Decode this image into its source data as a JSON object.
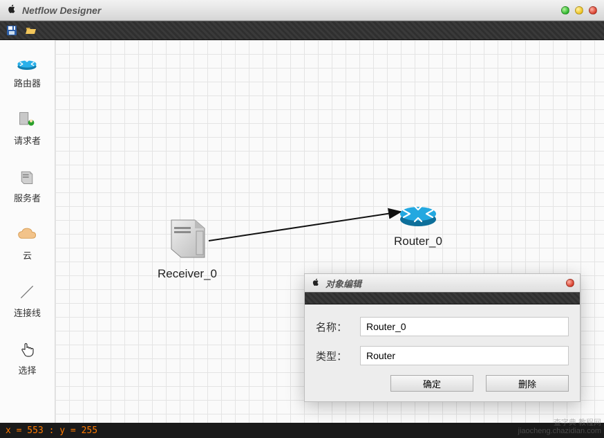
{
  "app": {
    "title": "Netflow Designer"
  },
  "palette": {
    "router_label": "路由器",
    "requester_label": "请求者",
    "server_label": "服务者",
    "cloud_label": "云",
    "link_label": "连接线",
    "select_label": "选择"
  },
  "canvas": {
    "node_receiver_label": "Receiver_0",
    "node_router_label": "Router_0"
  },
  "dialog": {
    "title": "对象编辑",
    "name_label": "名称：",
    "type_label": "类型：",
    "name_value": "Router_0",
    "type_value": "Router",
    "ok_label": "确定",
    "delete_label": "删除"
  },
  "status": {
    "text": "x = 553 : y = 255"
  },
  "watermark": {
    "line1": "查字典 教程网",
    "line2": "jiaocheng.chazidian.com"
  }
}
